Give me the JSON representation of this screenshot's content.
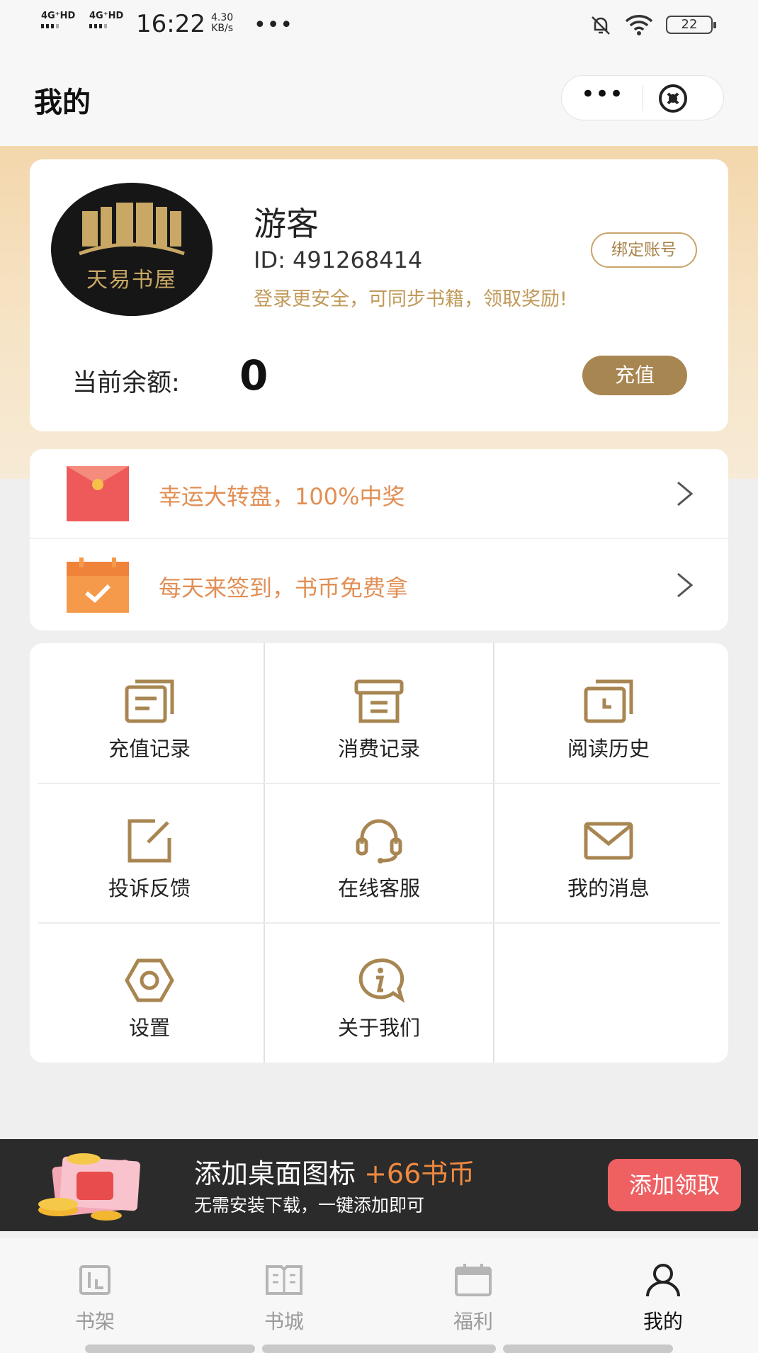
{
  "status_bar": {
    "signal_1": "4G⁺HD",
    "signal_2": "4G⁺HD",
    "time": "16:22",
    "speed_value": "4.30",
    "speed_unit": "KB/s",
    "dots": "•••",
    "battery": "22",
    "icons": [
      "mute-bell-icon",
      "wifi-icon",
      "battery-icon"
    ]
  },
  "header": {
    "title": "我的",
    "more": "•••",
    "icons": [
      "more-icon",
      "close-circle-icon"
    ]
  },
  "profile": {
    "avatar_brand": "天易书屋",
    "username": "游客",
    "id_text": "ID: 491268414",
    "hint": "登录更安全，可同步书籍，领取奖励!",
    "bind_label": "绑定账号",
    "balance_label": "当前余额:",
    "balance_value": "0",
    "recharge_label": "充值"
  },
  "promos": [
    {
      "label": "幸运大转盘，100%中奖",
      "icon": "red-envelope-icon"
    },
    {
      "label": "每天来签到，书币免费拿",
      "icon": "calendar-check-icon"
    }
  ],
  "menu": [
    {
      "label": "充值记录",
      "icon": "recharge-record-icon"
    },
    {
      "label": "消费记录",
      "icon": "consume-record-icon"
    },
    {
      "label": "阅读历史",
      "icon": "reading-history-icon"
    },
    {
      "label": "投诉反馈",
      "icon": "feedback-edit-icon"
    },
    {
      "label": "在线客服",
      "icon": "headset-icon"
    },
    {
      "label": "我的消息",
      "icon": "envelope-icon"
    },
    {
      "label": "设置",
      "icon": "settings-hex-icon"
    },
    {
      "label": "关于我们",
      "icon": "info-bubble-icon"
    }
  ],
  "banner": {
    "title": "添加桌面图标 ",
    "title_highlight": "+66书币",
    "subtitle": "无需安装下载，一键添加即可",
    "button": "添加领取"
  },
  "tabs": [
    {
      "label": "书架",
      "icon": "bookshelf-icon"
    },
    {
      "label": "书城",
      "icon": "book-city-icon"
    },
    {
      "label": "福利",
      "icon": "welfare-calendar-icon"
    },
    {
      "label": "我的",
      "icon": "person-icon",
      "active": true
    }
  ],
  "colors": {
    "accent_gold": "#a88651",
    "promo_orange": "#e18f55",
    "banner_button": "#ef6062",
    "highlight": "#f0893f"
  }
}
